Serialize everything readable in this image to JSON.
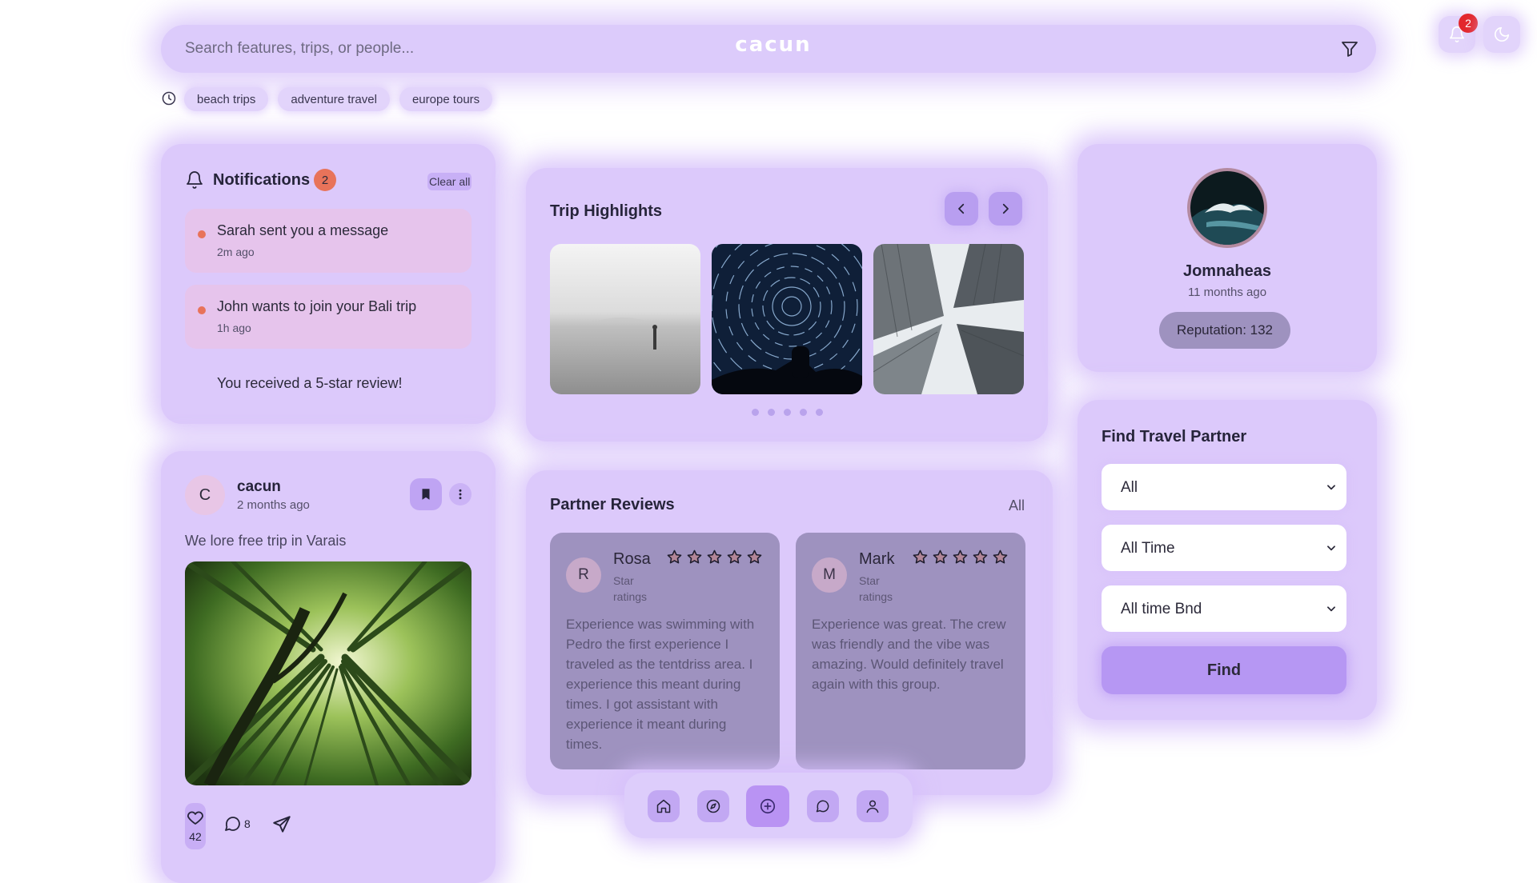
{
  "colors": {
    "accent": "#b697f3",
    "panel": "#dcc9fb",
    "badge_orange": "#e8735a",
    "badge_red": "#e3272c",
    "review_card": "#9e92bf",
    "star_outline": "#c9552f"
  },
  "search": {
    "placeholder": "Search features, trips, or people...",
    "brand": "cacun",
    "filter_icon": "filter-icon"
  },
  "top_bar": {
    "notification_count": "2",
    "notification_icon": "bell-icon",
    "theme_icon": "moon-icon"
  },
  "recent": {
    "icon": "clock-icon",
    "chips": [
      "beach trips",
      "adventure travel",
      "europe tours"
    ]
  },
  "notifications": {
    "title": "Notifications",
    "count": "2",
    "clear_label": "Clear all",
    "items": [
      {
        "text": "Sarah sent you a message",
        "time": "2m ago",
        "unread": true
      },
      {
        "text": "John wants to join your Bali trip",
        "time": "1h ago",
        "unread": true
      },
      {
        "text": "You received a 5-star review!",
        "time": "",
        "unread": false
      }
    ]
  },
  "post": {
    "avatar_letter": "C",
    "author": "cacun",
    "time": "2 months ago",
    "text": "We lore free trip in Varais",
    "image_icon": "bamboo-forest-photo",
    "likes": "42",
    "comments": "8"
  },
  "trip_highlights": {
    "title": "Trip Highlights",
    "photos": [
      "misty-lake-photo",
      "star-trails-photo",
      "skyscrapers-photo"
    ],
    "dots": 5
  },
  "reviews": {
    "title": "Partner Reviews",
    "all_label": "All",
    "items": [
      {
        "avatar_letter": "R",
        "name": "Rosa",
        "subtitle": "Star ratings",
        "stars": 5,
        "text": "Experience was swimming with Pedro the first experience I traveled as the tentdriss area. I experience this meant during times. I got assistant with experience it meant during times."
      },
      {
        "avatar_letter": "M",
        "name": "Mark",
        "subtitle": "Star ratings",
        "stars": 5,
        "text": "Experience was great. The crew was friendly and the vibe was amazing. Would definitely travel again with this group."
      }
    ]
  },
  "bottom_nav": {
    "items": [
      "home-icon",
      "compass-icon",
      "plus-circle-icon",
      "chat-icon",
      "user-icon"
    ],
    "active_index": 2
  },
  "profile": {
    "name": "Jomnaheas",
    "time": "11 months ago",
    "reputation": "Reputation: 132"
  },
  "find_partner": {
    "title": "Find Travel Partner",
    "select_1": "All",
    "select_2": "All Time",
    "select_3": "All time Bnd",
    "button_label": "Find"
  }
}
